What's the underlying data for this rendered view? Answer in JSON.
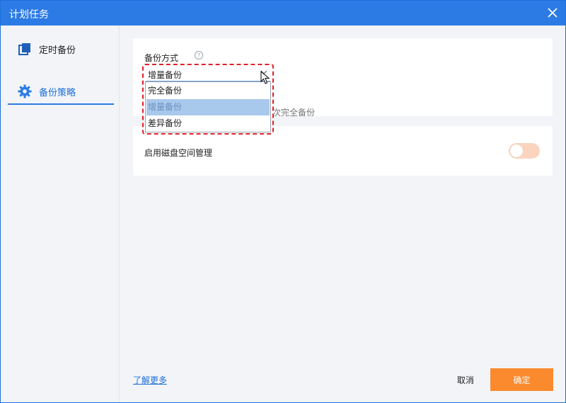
{
  "window": {
    "title": "计划任务",
    "close_icon": "close-icon"
  },
  "sidebar": {
    "items": [
      {
        "label": "定时备份",
        "icon": "copy-icon",
        "active": false
      },
      {
        "label": "备份策略",
        "icon": "gear-icon",
        "active": true
      }
    ]
  },
  "backup_method": {
    "label": "备份方式",
    "help_icon": "question-circle-icon",
    "selected": "增量备份",
    "options": [
      "完全备份",
      "增量备份",
      "差异备份"
    ],
    "description_fragment": "次完全备份"
  },
  "disk_management": {
    "label": "启用磁盘空间管理",
    "enabled": false
  },
  "footer": {
    "learn_more": "了解更多",
    "cancel": "取消",
    "confirm": "确定"
  },
  "colors": {
    "titlebar": "#2c7be5",
    "accent": "#1e6fd9",
    "confirm_button": "#fb8a2e",
    "toggle_off": "#fbd4bf",
    "highlight_border": "#e0202a",
    "selected_option": "#a9c9ec"
  }
}
